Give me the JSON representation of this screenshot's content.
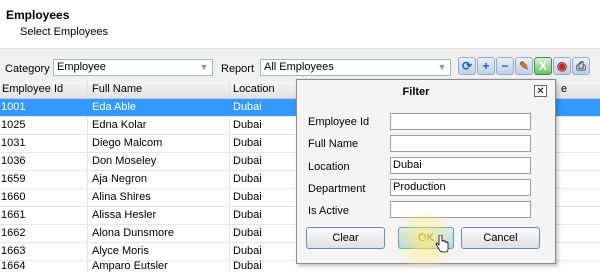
{
  "header": {
    "title": "Employees",
    "subtitle": "Select Employees"
  },
  "toolbar": {
    "category_label": "Category",
    "category_value": "Employee",
    "report_label": "Report",
    "report_value": "All Employees"
  },
  "grid": {
    "columns": [
      "Employee Id",
      "Full Name",
      "Location",
      "e"
    ],
    "rows": [
      {
        "id": "1001",
        "name": "Eda Able",
        "location": "Dubai"
      },
      {
        "id": "1025",
        "name": "Edna Kolar",
        "location": "Dubai"
      },
      {
        "id": "1031",
        "name": "Diego Malcom",
        "location": "Dubai"
      },
      {
        "id": "1036",
        "name": "Don Moseley",
        "location": "Dubai"
      },
      {
        "id": "1659",
        "name": "Aja Negron",
        "location": "Dubai"
      },
      {
        "id": "1660",
        "name": "Alina Shires",
        "location": "Dubai"
      },
      {
        "id": "1661",
        "name": "Alissa Hesler",
        "location": "Dubai"
      },
      {
        "id": "1662",
        "name": "Alona Dunsmore",
        "location": "Dubai"
      },
      {
        "id": "1663",
        "name": "Alyce Moris",
        "location": "Dubai"
      },
      {
        "id": "1664",
        "name": "Amparo Eutsler",
        "location": "Dubai"
      }
    ]
  },
  "dialog": {
    "title": "Filter",
    "close_label": "✕",
    "fields": [
      {
        "label": "Employee Id",
        "value": ""
      },
      {
        "label": "Full Name",
        "value": ""
      },
      {
        "label": "Location",
        "value": "Dubai"
      },
      {
        "label": "Department",
        "value": "Production"
      },
      {
        "label": "Is Active",
        "value": ""
      }
    ],
    "buttons": {
      "clear": "Clear",
      "ok": "OK",
      "cancel": "Cancel"
    }
  }
}
